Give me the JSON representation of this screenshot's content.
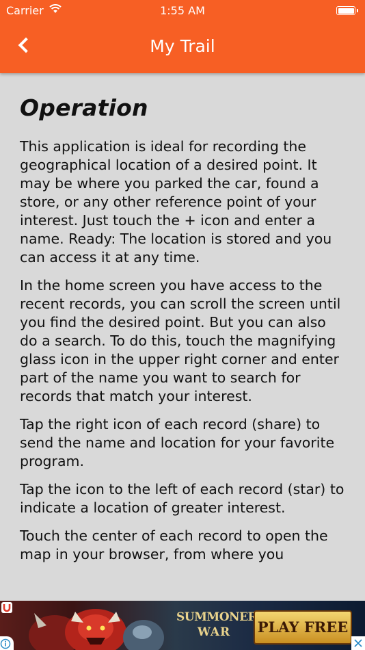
{
  "status_bar": {
    "carrier": "Carrier",
    "time": "1:55 AM",
    "wifi_icon": "wifi-icon",
    "battery_icon": "battery-full-icon"
  },
  "nav": {
    "title": "My Trail",
    "back_icon": "chevron-left-icon"
  },
  "article": {
    "heading": "Operation",
    "paragraphs": [
      "This application is ideal for recording the geographical location of a desired point. It may be where you parked the car, found a store, or any other reference point of your interest. Just touch the + icon and enter a name. Ready: The location is stored and you can access it at any time.",
      "In the home screen you have access to the recent records, you can scroll the screen until you find the desired point. But you can also do a search. To do this, touch the magnifying glass icon in the upper right corner and enter part of the name you want to search for records that match your interest.",
      "Tap the right icon of each record (share) to send the name and location for your favorite program.",
      "Tap the icon to the left of each record (star) to indicate a location of greater interest.",
      "Touch the center of each record to open the map in your browser, from where you"
    ]
  },
  "ad": {
    "logo_line1": "SUMMONERS",
    "logo_line2": "WAR",
    "cta": "PLAY FREE"
  },
  "colors": {
    "header": "#f75f24",
    "background": "#d9d9d9",
    "text": "#111111"
  }
}
